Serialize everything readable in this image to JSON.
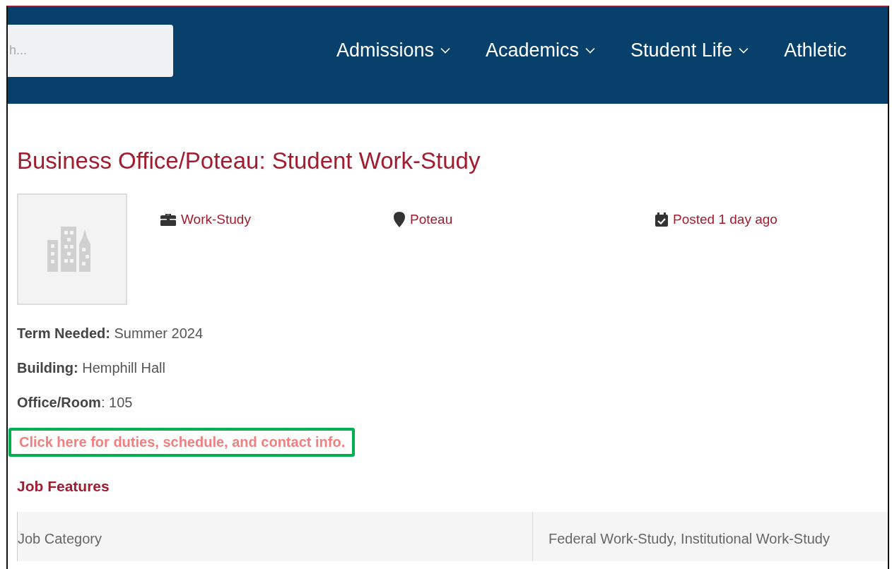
{
  "nav": {
    "search": {
      "placeholder": "h..."
    },
    "items": [
      {
        "label": "Admissions",
        "dropdown": true
      },
      {
        "label": "Academics",
        "dropdown": true
      },
      {
        "label": "Student Life",
        "dropdown": true
      },
      {
        "label": "Athletic",
        "dropdown": false
      }
    ]
  },
  "job": {
    "title": "Business Office/Poteau: Student Work-Study",
    "meta": [
      {
        "kind": "type",
        "text": "Work-Study"
      },
      {
        "kind": "location",
        "text": "Poteau"
      },
      {
        "kind": "posted",
        "text": "Posted 1 day ago"
      }
    ],
    "fields": [
      "**Term Needed:** Summer 2024",
      "**Building:** Hemphill Hall",
      "**Office/Room**: 105"
    ],
    "link": {
      "text": "Click here for duties, schedule, and contact info.",
      "highlighted": true
    },
    "features_heading": "Job Features",
    "features": [
      {
        "label": "Job Category",
        "value": "Federal Work-Study, Institutional Work-Study"
      }
    ]
  }
}
